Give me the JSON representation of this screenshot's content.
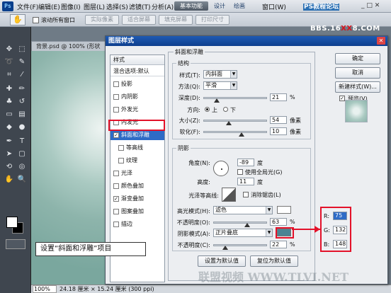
{
  "menubar": {
    "logo": "Ps",
    "items": [
      "文件(F)",
      "编辑(E)",
      "图像(I)",
      "图层(L)",
      "选择(S)",
      "滤镜(T)",
      "分析(A)"
    ],
    "workspace_button": "基本功能",
    "workspace_links": [
      "设计",
      "绘画"
    ],
    "window_menu": "窗口(W)",
    "watermark": "PS教程论坛",
    "window_controls": "_ □ ✕"
  },
  "options_bar": {
    "scroll_all_label": "滚动所有窗口",
    "buttons": [
      "实际像素",
      "适合屏幕",
      "填充屏幕",
      "打印尺寸"
    ],
    "watermark_prefix": "BBS.16",
    "watermark_red": "XX",
    "watermark_suffix": "8.COM"
  },
  "document": {
    "tab_title": "背景.psd @ 100% (形状",
    "zoom": "100%",
    "size": "24.18 厘米 × 15.24 厘米 (300 ppi)"
  },
  "dialog": {
    "title": "图层样式",
    "styles_header": "样式",
    "blend_options": "混合选项:默认",
    "styles": [
      {
        "label": "投影",
        "checked": false,
        "sub": false,
        "selected": false
      },
      {
        "label": "内阴影",
        "checked": false,
        "sub": false,
        "selected": false
      },
      {
        "label": "外发光",
        "checked": false,
        "sub": false,
        "selected": false
      },
      {
        "label": "内发光",
        "checked": false,
        "sub": false,
        "selected": false
      },
      {
        "label": "斜面和浮雕",
        "checked": true,
        "sub": false,
        "selected": true
      },
      {
        "label": "等高线",
        "checked": false,
        "sub": true,
        "selected": false
      },
      {
        "label": "纹理",
        "checked": false,
        "sub": true,
        "selected": false
      },
      {
        "label": "光泽",
        "checked": false,
        "sub": false,
        "selected": false
      },
      {
        "label": "颜色叠加",
        "checked": false,
        "sub": false,
        "selected": false
      },
      {
        "label": "渐变叠加",
        "checked": true,
        "sub": false,
        "selected": false
      },
      {
        "label": "图案叠加",
        "checked": false,
        "sub": false,
        "selected": false
      },
      {
        "label": "描边",
        "checked": false,
        "sub": false,
        "selected": false
      }
    ],
    "group_title": "斜面和浮雕",
    "structure": {
      "title": "结构",
      "style_label": "样式(T):",
      "style_value": "内斜面",
      "technique_label": "方法(Q):",
      "technique_value": "平滑",
      "depth_label": "深度(D):",
      "depth_value": "21",
      "depth_unit": "%",
      "depth_level": 0.21,
      "direction_label": "方向:",
      "direction_up": "上",
      "direction_down": "下",
      "size_label": "大小(Z):",
      "size_value": "54",
      "size_unit": "像素",
      "size_level": 0.4,
      "soften_label": "软化(F):",
      "soften_value": "10",
      "soften_unit": "像素",
      "soften_level": 0.6
    },
    "shading": {
      "title": "阴影",
      "angle_label": "角度(N):",
      "angle_value": "-89",
      "angle_unit": "度",
      "global_light_label": "使用全局光(G)",
      "altitude_label": "高度:",
      "altitude_value": "11",
      "altitude_unit": "度",
      "gloss_label": "光泽等高线:",
      "antialias_label": "消除锯齿(L)",
      "highlight_mode_label": "高光模式(H):",
      "highlight_mode_value": "滤色",
      "highlight_opacity_label": "不透明度(O):",
      "highlight_opacity_value": "63",
      "highlight_opacity_level": 0.63,
      "shadow_mode_label": "阴影模式(A):",
      "shadow_mode_value": "正片叠底",
      "shadow_opacity_label": "不透明度(C):",
      "shadow_opacity_value": "22",
      "shadow_opacity_level": 0.22,
      "percent": "%"
    },
    "default_button": "设置为默认值",
    "reset_button": "复位为默认值",
    "ok_button": "确定",
    "cancel_button": "取消",
    "new_style_button": "新建样式(W)...",
    "preview_label": "预览(V)"
  },
  "annotation": {
    "callout": "设置“斜面和浮雕”项目",
    "rgb": [
      {
        "label": "R:",
        "value": "75"
      },
      {
        "label": "G:",
        "value": "132"
      },
      {
        "label": "B:",
        "value": "148"
      }
    ],
    "watermark": "联盟视频 WWW.TLVI.NET"
  },
  "colors": {
    "highlight_color": "#ffffff",
    "shadow_color": "#4a8494",
    "accent": "#e3122a",
    "selection": "#2e6bc6"
  }
}
